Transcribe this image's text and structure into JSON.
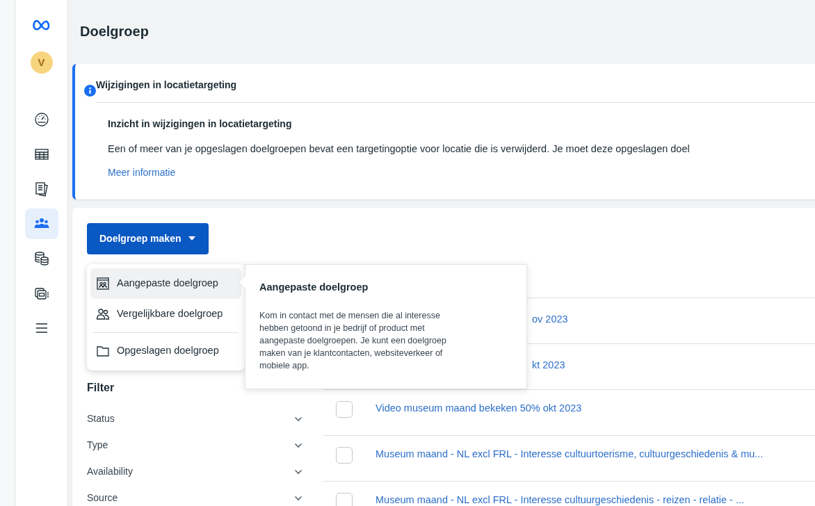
{
  "sidebar": {
    "avatar": "V",
    "items": [
      {
        "selected": false
      },
      {
        "selected": false
      },
      {
        "selected": false
      },
      {
        "selected": true
      },
      {
        "selected": false
      },
      {
        "selected": false
      },
      {
        "selected": false
      }
    ]
  },
  "page": {
    "title": "Doelgroep"
  },
  "notice": {
    "title": "Wijzigingen in locatietargeting",
    "subtitle": "Inzicht in wijzigingen in locatietargeting",
    "body": "Een of meer van je opgeslagen doelgroepen bevat een targetingoptie voor locatie die is verwijderd. Je moet deze opgeslagen doel",
    "link": "Meer informatie"
  },
  "create_button": {
    "label": "Doelgroep maken",
    "expanded": true
  },
  "menu": [
    {
      "label": "Aangepaste doelgroep",
      "selected": true
    },
    {
      "label": "Vergelijkbare doelgroep",
      "selected": false
    },
    {
      "label": "Opgeslagen doelgroep",
      "selected": false
    }
  ],
  "popover": {
    "title": "Aangepaste doelgroep",
    "body": "Kom in contact met de mensen die al interesse hebben getoond in je bedrijf of product met aangepaste doelgroepen. Je kunt een doelgroep maken van je klantcontacten, websiteverkeer of mobiele app."
  },
  "filter": {
    "title": "Filter",
    "items": [
      "Status",
      "Type",
      "Availability",
      "Source"
    ]
  },
  "rows": [
    {
      "kind": "covered",
      "name": "ov 2023"
    },
    {
      "kind": "covered",
      "name": "kt 2023"
    },
    {
      "kind": "full",
      "name": "Video museum maand bekeken 50% okt 2023",
      "checked": false
    },
    {
      "kind": "full",
      "name": "Museum maand - NL excl FRL - Interesse cultuurtoerisme, cultuurgeschiedenis & mu...",
      "checked": false
    },
    {
      "kind": "full",
      "name": "Museum maand - NL excl FRL - Interesse cultuurgeschiedenis - reizen - relatie - ...",
      "checked": false
    }
  ]
}
